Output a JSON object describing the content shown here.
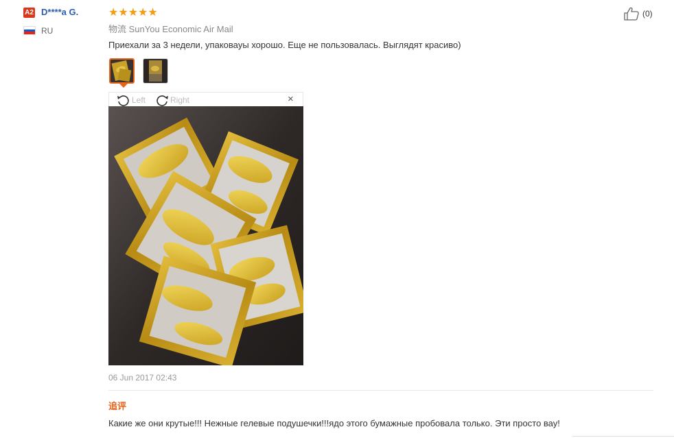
{
  "reviewer": {
    "level_badge": "A2",
    "name": "D****a G.",
    "country_code": "RU",
    "flag_colors": [
      "#ffffff",
      "#1c56c8",
      "#d52b1e"
    ]
  },
  "review": {
    "rating": 5,
    "stars": "★★★★★",
    "star_color": "#f39c12",
    "logistics_cn": "物流",
    "logistics_method": "SunYou Economic Air Mail",
    "text": "Приехали за 3 недели, упаковаyы хорошо. Еще не пользовалась. Выглядят красиво)",
    "date": "06 Jun 2017 02:43",
    "helpful_count": "(0)"
  },
  "viewer": {
    "rotate_left_label": "Left",
    "rotate_right_label": "Right",
    "close_symbol": "×"
  },
  "additional_feedback": {
    "label": "追评",
    "text": "Какие же они крутые!!! Нежные гелевые подушечки!!!ядо этого бумажные пробовала только. Эти просто вау!"
  },
  "colors": {
    "accent": "#e8631a",
    "link": "#2a5db0"
  }
}
